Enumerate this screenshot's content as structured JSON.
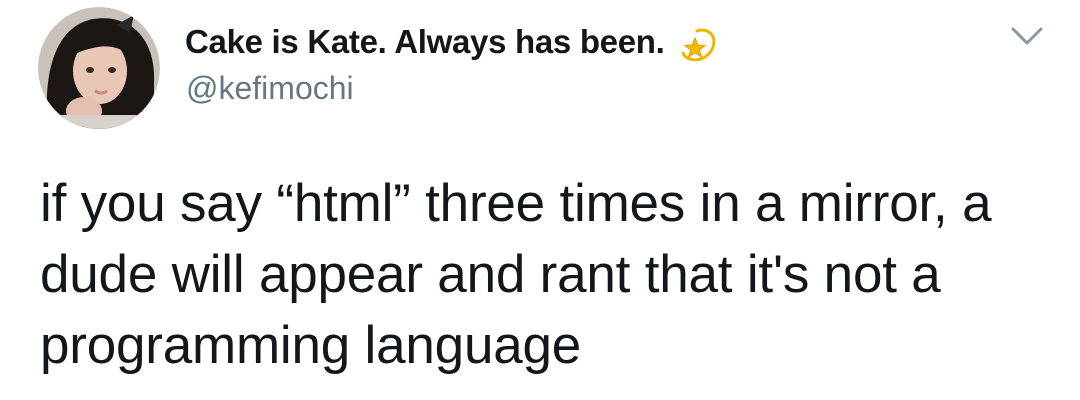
{
  "author": {
    "display_name": "Cake is Kate. Always has been.",
    "name_emoji": "dizzy-star-emoji",
    "handle": "@kefimochi",
    "avatar": "profile-photo"
  },
  "tweet": {
    "text": "if you say “html” three times in a mirror, a dude will appear and rant that it's not a programming language"
  },
  "icons": {
    "menu": "chevron-down-icon"
  },
  "colors": {
    "primary_text": "#14171a",
    "secondary_text": "#657786",
    "background": "#ffffff",
    "emoji_star": "#f5b800"
  }
}
